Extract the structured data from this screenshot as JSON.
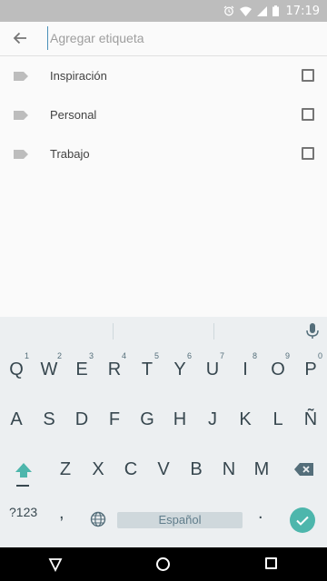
{
  "status_bar": {
    "time": "17:19"
  },
  "search": {
    "placeholder": "Agregar etiqueta",
    "value": ""
  },
  "labels": [
    {
      "name": "Inspiración",
      "checked": false
    },
    {
      "name": "Personal",
      "checked": false
    },
    {
      "name": "Trabajo",
      "checked": false
    }
  ],
  "keyboard": {
    "row1": [
      "Q",
      "W",
      "E",
      "R",
      "T",
      "Y",
      "U",
      "I",
      "O",
      "P"
    ],
    "row1_numbers": [
      "1",
      "2",
      "3",
      "4",
      "5",
      "6",
      "7",
      "8",
      "9",
      "0"
    ],
    "row2": [
      "A",
      "S",
      "D",
      "F",
      "G",
      "H",
      "J",
      "K",
      "L",
      "Ñ"
    ],
    "row3": [
      "Z",
      "X",
      "C",
      "V",
      "B",
      "N",
      "M"
    ],
    "symbols_label": "?123",
    "comma": ",",
    "period": ".",
    "space_label": "Español"
  },
  "colors": {
    "accent": "#4db6ac",
    "status_bar": "#bdbdbd",
    "keyboard_bg": "#eceff1"
  }
}
